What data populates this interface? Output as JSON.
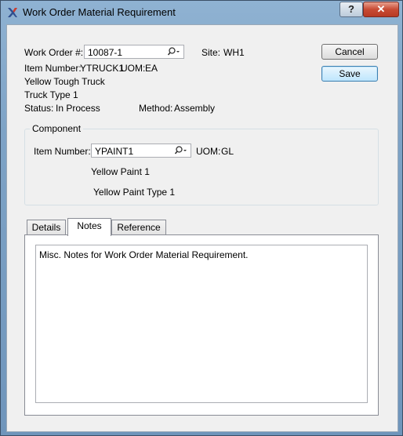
{
  "window": {
    "title": "Work Order Material Requirement",
    "help": "?",
    "close": "✕"
  },
  "work_order": {
    "label": "Work Order #:",
    "value": "10087-1",
    "site_label": "Site:",
    "site_value": "WH1",
    "item_number_label": "Item Number:",
    "item_number_value": "YTRUCK1",
    "uom_label": "UOM:",
    "uom_value": "EA",
    "description1": "Yellow Tough Truck",
    "description2": "Truck Type 1",
    "status_label": "Status:",
    "status_value": "In Process",
    "method_label": "Method:",
    "method_value": "Assembly"
  },
  "buttons": {
    "cancel": "Cancel",
    "save": "Save"
  },
  "component": {
    "group_title": "Component",
    "item_number_label": "Item Number:",
    "item_number_value": "YPAINT1",
    "uom_label": "UOM:",
    "uom_value": "GL",
    "description1": "Yellow Paint 1",
    "description2": "Yellow Paint Type 1"
  },
  "tabs": [
    {
      "label": "Details",
      "active": false
    },
    {
      "label": "Notes",
      "active": true
    },
    {
      "label": "Reference",
      "active": false
    }
  ],
  "notes": {
    "text": "Misc. Notes for Work Order Material Requirement."
  },
  "colors": {
    "title_bar": "#7ea3c6",
    "close_button": "#c84b34",
    "default_button": "#3c7fb1"
  }
}
